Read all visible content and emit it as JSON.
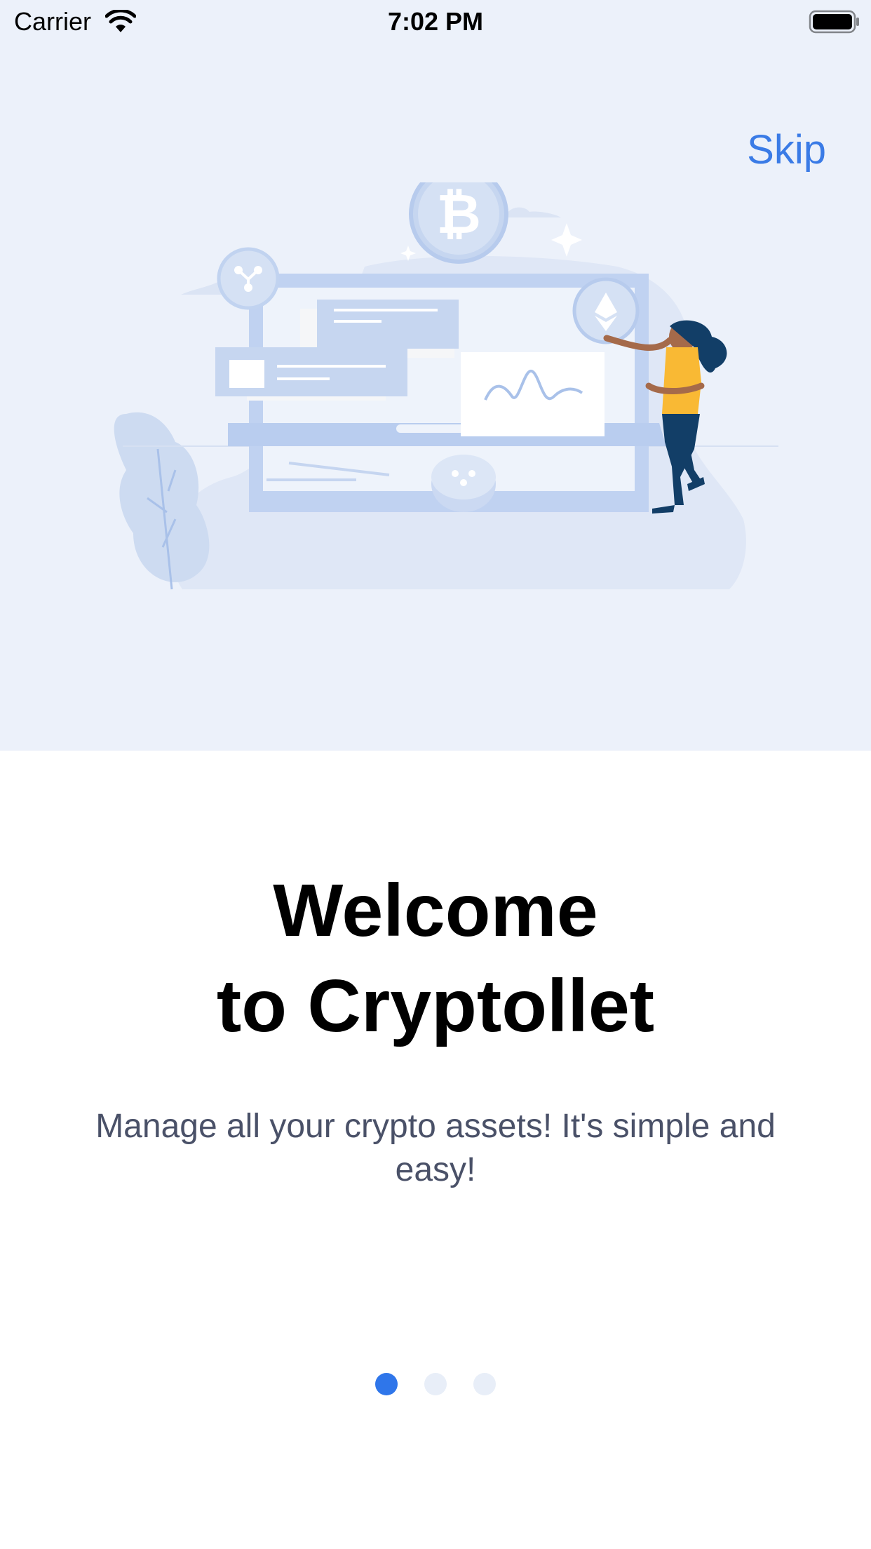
{
  "status_bar": {
    "carrier": "Carrier",
    "time": "7:02 PM"
  },
  "header": {
    "skip_label": "Skip"
  },
  "onboarding": {
    "title_line1": "Welcome",
    "title_line2": "to Cryptollet",
    "subtitle": "Manage all your crypto assets! It's simple and easy!"
  },
  "pager": {
    "total": 3,
    "current": 1
  },
  "colors": {
    "accent": "#2f76ea",
    "skip": "#3a7be6",
    "top_background": "#ecf1fa",
    "dot_inactive": "#e8eef8"
  },
  "icons": [
    "wifi-icon",
    "battery-icon",
    "bitcoin-icon",
    "ethereum-icon",
    "ripple-icon"
  ]
}
